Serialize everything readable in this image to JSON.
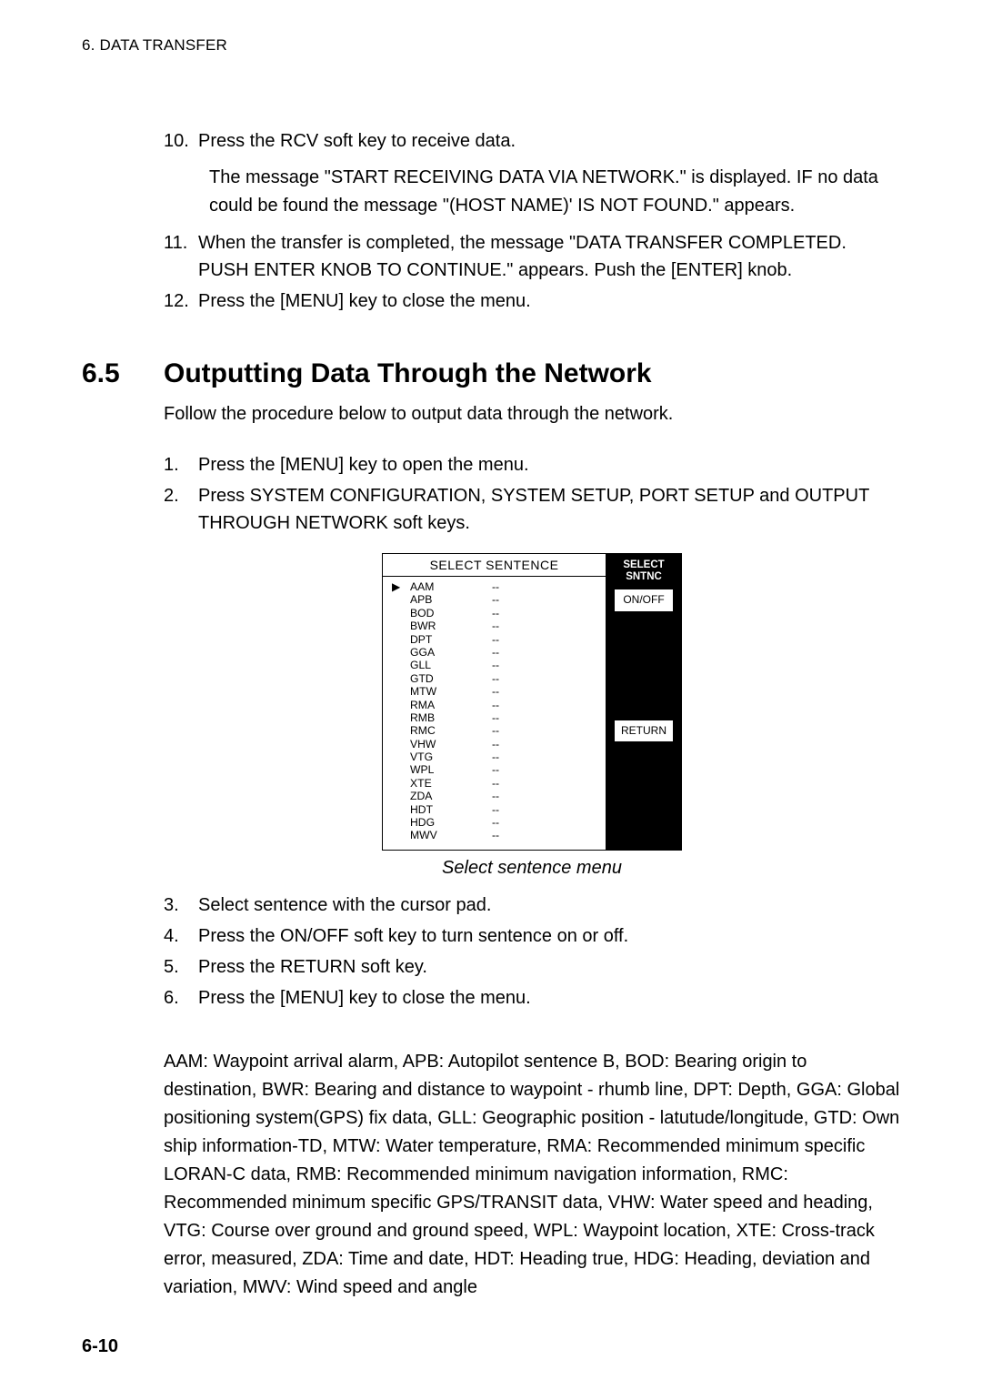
{
  "header": "6. DATA TRANSFER",
  "steps_a": [
    {
      "num": "10.",
      "text": "Press the RCV soft key to receive data."
    }
  ],
  "sub_a": "The message \"START RECEIVING DATA VIA NETWORK.\" is displayed. IF no data could be found the message \"(HOST NAME)' IS NOT FOUND.\" appears.",
  "steps_b": [
    {
      "num": "11.",
      "text": "When the transfer is completed, the message \"DATA TRANSFER COMPLETED. PUSH ENTER KNOB TO CONTINUE.\" appears. Push the [ENTER] knob."
    },
    {
      "num": "12.",
      "text": "Press the [MENU] key to close the menu."
    }
  ],
  "section": {
    "num": "6.5",
    "title": "Outputting Data Through the Network"
  },
  "intro": "Follow the procedure below to output data through the network.",
  "steps_c": [
    {
      "num": "1.",
      "text": "Press the [MENU] key to open the menu."
    },
    {
      "num": "2.",
      "text": "Press SYSTEM CONFIGURATION, SYSTEM SETUP, PORT SETUP and OUTPUT THROUGH NETWORK soft keys."
    }
  ],
  "diagram": {
    "title": "SELECT SENTENCE",
    "rows": [
      {
        "arrow": "▶",
        "code": "AAM",
        "val": "--"
      },
      {
        "arrow": "",
        "code": "APB",
        "val": "--"
      },
      {
        "arrow": "",
        "code": "BOD",
        "val": "--"
      },
      {
        "arrow": "",
        "code": "BWR",
        "val": "--"
      },
      {
        "arrow": "",
        "code": "DPT",
        "val": "--"
      },
      {
        "arrow": "",
        "code": "GGA",
        "val": "--"
      },
      {
        "arrow": "",
        "code": "GLL",
        "val": "--"
      },
      {
        "arrow": "",
        "code": "GTD",
        "val": "--"
      },
      {
        "arrow": "",
        "code": "MTW",
        "val": "--"
      },
      {
        "arrow": "",
        "code": "RMA",
        "val": "--"
      },
      {
        "arrow": "",
        "code": "RMB",
        "val": "--"
      },
      {
        "arrow": "",
        "code": "RMC",
        "val": "--"
      },
      {
        "arrow": "",
        "code": "VHW",
        "val": "--"
      },
      {
        "arrow": "",
        "code": "VTG",
        "val": "--"
      },
      {
        "arrow": "",
        "code": "WPL",
        "val": "--"
      },
      {
        "arrow": "",
        "code": "XTE",
        "val": "--"
      },
      {
        "arrow": "",
        "code": "ZDA",
        "val": "--"
      },
      {
        "arrow": "",
        "code": "HDT",
        "val": "--"
      },
      {
        "arrow": "",
        "code": "HDG",
        "val": "--"
      },
      {
        "arrow": "",
        "code": "MWV",
        "val": "--"
      }
    ],
    "right": {
      "topLabel": "SELECT\nSNTNC",
      "btn1": "ON/OFF",
      "btn2": "RETURN"
    }
  },
  "figCaption": "Select sentence menu",
  "steps_d": [
    {
      "num": "3.",
      "text": "Select sentence with the cursor pad."
    },
    {
      "num": "4.",
      "text": "Press the ON/OFF soft key to turn sentence on or off."
    },
    {
      "num": "5.",
      "text": "Press the RETURN soft key."
    },
    {
      "num": "6.",
      "text": "Press the [MENU] key to close the menu."
    }
  ],
  "glossary": "AAM: Waypoint arrival alarm, APB: Autopilot sentence B, BOD: Bearing origin to destination, BWR: Bearing and distance to waypoint - rhumb line, DPT: Depth, GGA: Global positioning system(GPS) fix data, GLL: Geographic position - latutude/longitude, GTD: Own ship information-TD, MTW: Water temperature, RMA: Recommended minimum specific LORAN-C data, RMB: Recommended minimum navigation information, RMC: Recommended minimum specific GPS/TRANSIT data, VHW: Water speed and heading, VTG: Course over ground and ground speed, WPL: Waypoint location, XTE: Cross-track error, measured, ZDA: Time and date, HDT: Heading true, HDG: Heading, deviation and variation, MWV: Wind speed and angle",
  "pageNumber": "6-10"
}
